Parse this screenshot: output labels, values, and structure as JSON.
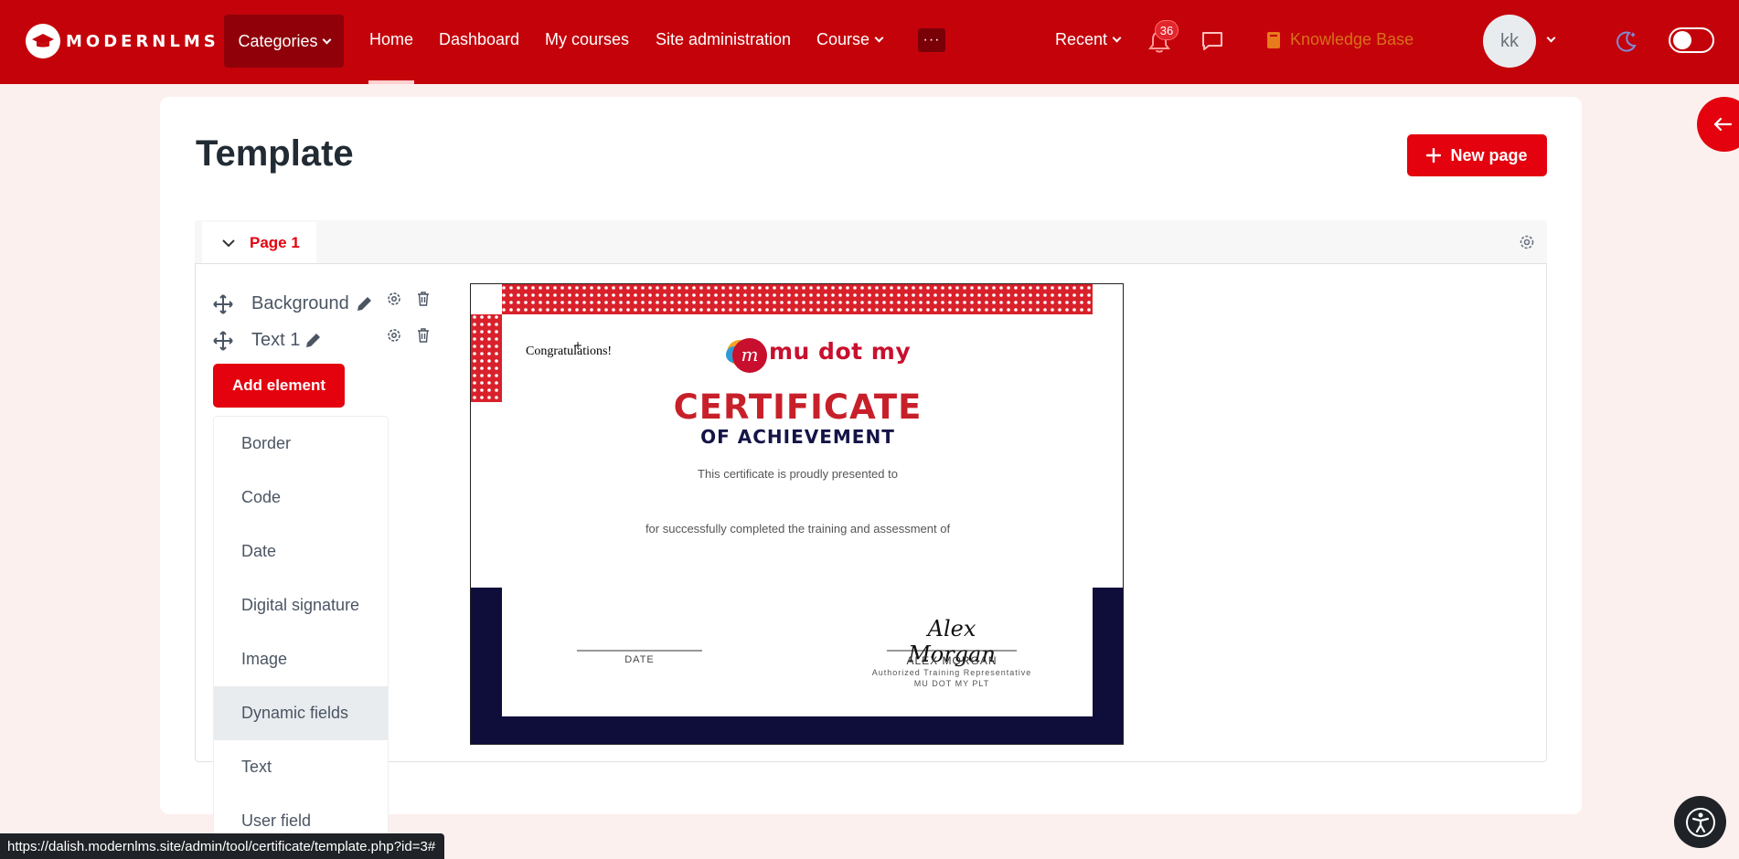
{
  "navbar": {
    "brand": "MODERNLMS",
    "categories": "Categories",
    "links": [
      "Home",
      "Dashboard",
      "My courses",
      "Site administration",
      "Course"
    ],
    "more": "···",
    "recent": "Recent",
    "notif_count": "36",
    "knowledge_base": "Knowledge Base",
    "avatar_initials": "kk"
  },
  "main": {
    "title": "Template",
    "new_page": "New page",
    "page_tab": "Page 1"
  },
  "elements": [
    {
      "name": "Background"
    },
    {
      "name": "Text 1"
    }
  ],
  "add_element": "Add element",
  "element_types": [
    "Border",
    "Code",
    "Date",
    "Digital signature",
    "Image",
    "Dynamic fields",
    "Text",
    "User field"
  ],
  "certificate": {
    "congrats": "Congratulations!",
    "brand": "mu dot my",
    "title": "CERTIFICATE",
    "subtitle": "OF ACHIEVEMENT",
    "presented": "This certificate is proudly presented to",
    "completed": "for successfully completed the training and assessment of",
    "date_label": "DATE",
    "signature": "Alex Morgan",
    "signer": "ALEX MORGAN",
    "signer_role": "Authorized Training Representative",
    "signer_org": "MU DOT MY PLT"
  },
  "status_url": "https://dalish.modernlms.site/admin/tool/certificate/template.php?id=3#",
  "colors": {
    "brand_red": "#c4020a",
    "accent_red": "#e3020e",
    "navy": "#0f0e3b"
  }
}
